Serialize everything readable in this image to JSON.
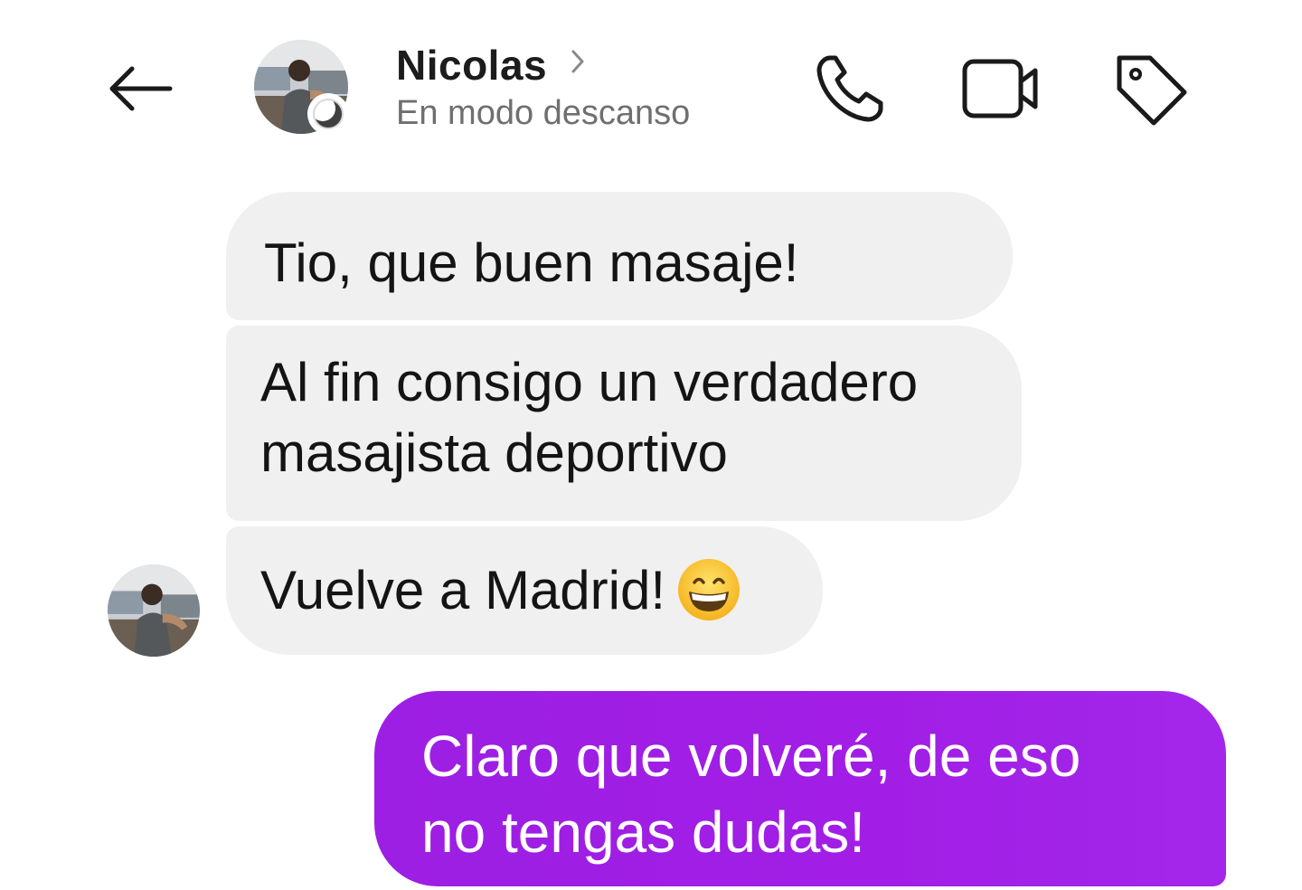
{
  "header": {
    "contact_name": "Nicolas",
    "status": "En modo descanso",
    "icons": {
      "back": "arrow-left-icon",
      "chevron": "chevron-right-icon",
      "badge": "moon-icon",
      "call": "phone-icon",
      "video": "video-camera-icon",
      "tag": "tag-icon"
    }
  },
  "messages": {
    "incoming": [
      {
        "text": "Tio, que buen masaje!"
      },
      {
        "text": "Al fin consigo un verdadero\nmasajista deportivo"
      },
      {
        "text": "Vuelve a Madrid!",
        "emoji": "grinning-face-icon"
      }
    ],
    "outgoing": [
      {
        "text": "Claro que volveré, de eso\nno tengas dudas!"
      }
    ]
  },
  "colors": {
    "incoming_bubble": "#f0f0f0",
    "outgoing_bubble": "#a21ee6",
    "status_text": "#6f6f6f"
  }
}
